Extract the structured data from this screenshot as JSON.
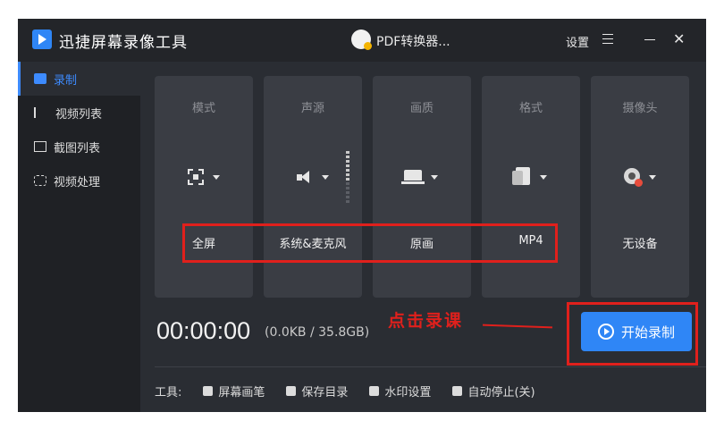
{
  "window": {
    "title": "迅捷屏幕录像工具",
    "pdf_label": "PDF转换器...",
    "settings_label": "设置"
  },
  "sidebar": {
    "items": [
      {
        "label": "录制"
      },
      {
        "label": "视频列表"
      },
      {
        "label": "截图列表"
      },
      {
        "label": "视频处理"
      }
    ]
  },
  "cards": [
    {
      "label": "模式",
      "value": "全屏",
      "icon": "fullscreen-icon"
    },
    {
      "label": "声源",
      "value": "系统&麦克风",
      "icon": "speaker-icon"
    },
    {
      "label": "画质",
      "value": "原画",
      "icon": "laptop-icon"
    },
    {
      "label": "格式",
      "value": "MP4",
      "icon": "file-icon"
    },
    {
      "label": "摄像头",
      "value": "无设备",
      "icon": "camera-icon"
    }
  ],
  "recording": {
    "timer": "00:00:00",
    "size": "(0.0KB / 35.8GB)",
    "start_label": "开始录制"
  },
  "annotation": {
    "text": "点击录课"
  },
  "tools": {
    "label": "工具:",
    "items": [
      "屏幕画笔",
      "保存目录",
      "水印设置",
      "自动停止(关)"
    ]
  },
  "colors": {
    "accent": "#2f86f6",
    "highlight": "#e0201c",
    "background": "#2a2d33"
  }
}
